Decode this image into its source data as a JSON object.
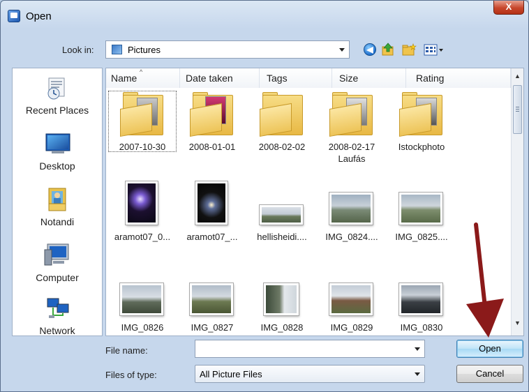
{
  "window": {
    "title": "Open",
    "close_glyph": "X"
  },
  "toolbar": {
    "look_in_label": "Look in:",
    "look_in_value": "Pictures",
    "icons": [
      "back-icon",
      "up-folder-icon",
      "new-folder-icon",
      "views-menu-icon"
    ]
  },
  "places": [
    {
      "label": "Recent Places",
      "icon": "recent-places-icon"
    },
    {
      "label": "Desktop",
      "icon": "desktop-icon"
    },
    {
      "label": "Notandi",
      "icon": "user-folder-icon"
    },
    {
      "label": "Computer",
      "icon": "computer-icon"
    },
    {
      "label": "Network",
      "icon": "network-icon"
    }
  ],
  "columns": [
    "Name",
    "Date taken",
    "Tags",
    "Size",
    "Rating"
  ],
  "items": [
    {
      "name": "2007-10-30",
      "kind": "folder",
      "selected": true
    },
    {
      "name": "2008-01-01",
      "kind": "folder"
    },
    {
      "name": "2008-02-02",
      "kind": "folder"
    },
    {
      "name": "2008-02-17",
      "name_line2": "Laufás",
      "kind": "folder"
    },
    {
      "name": "Istockphoto",
      "kind": "folder"
    },
    {
      "name": "aramot07_0...",
      "kind": "image"
    },
    {
      "name": "aramot07_...",
      "kind": "image"
    },
    {
      "name": "hellisheidi....",
      "kind": "image"
    },
    {
      "name": "IMG_0824....",
      "kind": "image"
    },
    {
      "name": "IMG_0825....",
      "kind": "image"
    },
    {
      "name": "IMG_0826",
      "kind": "image"
    },
    {
      "name": "IMG_0827",
      "kind": "image"
    },
    {
      "name": "IMG_0828",
      "kind": "image"
    },
    {
      "name": "IMG_0829",
      "kind": "image"
    },
    {
      "name": "IMG_0830",
      "kind": "image"
    }
  ],
  "footer": {
    "file_name_label": "File name:",
    "file_name_value": "",
    "files_of_type_label": "Files of type:",
    "files_of_type_value": "All Picture Files",
    "open_label": "Open",
    "cancel_label": "Cancel"
  },
  "colors": {
    "annotation_arrow": "#8b1a1a",
    "window_chrome": "#c6d7ec"
  }
}
